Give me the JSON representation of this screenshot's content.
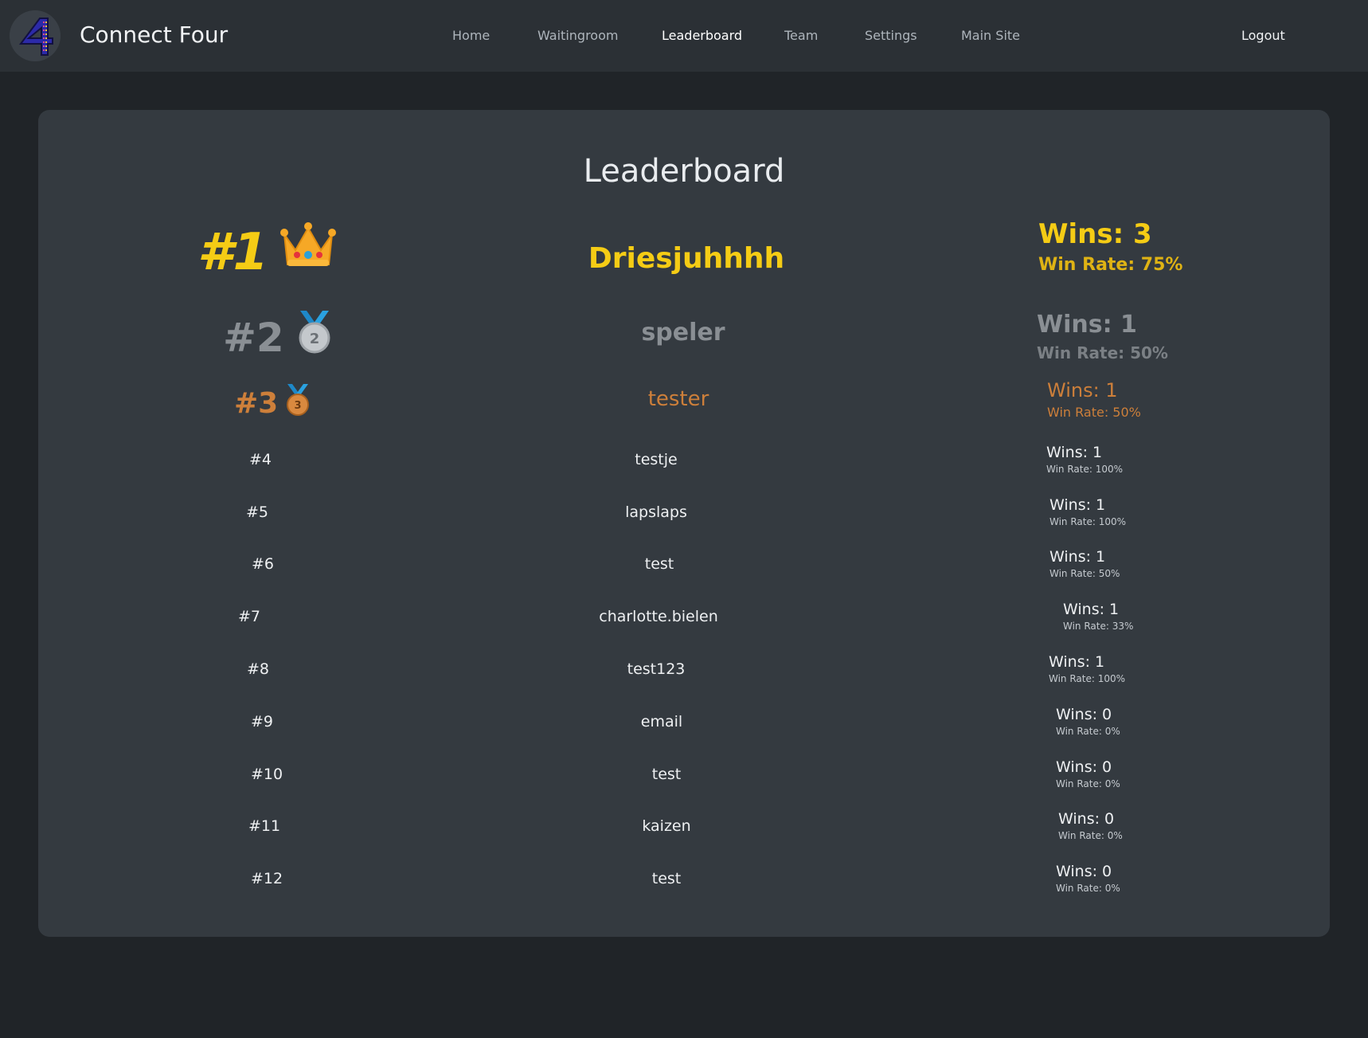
{
  "navbar": {
    "brand": "Connect Four",
    "links": [
      {
        "label": "Home"
      },
      {
        "label": "Waitingroom"
      },
      {
        "label": "Leaderboard"
      },
      {
        "label": "Team"
      },
      {
        "label": "Settings"
      },
      {
        "label": "Main Site"
      }
    ],
    "logout": "Logout",
    "active": "Leaderboard"
  },
  "leaderboard": {
    "title": "Leaderboard",
    "rows": [
      {
        "rank": "#1",
        "name": "Driesjuhhhh",
        "wins": "Wins: 3",
        "rate": "Win Rate: 75%",
        "icon": "crown-icon"
      },
      {
        "rank": "#2",
        "name": "speler",
        "wins": "Wins: 1",
        "rate": "Win Rate: 50%",
        "icon": "silver-medal-icon"
      },
      {
        "rank": "#3",
        "name": "tester",
        "wins": "Wins: 1",
        "rate": "Win Rate: 50%",
        "icon": "bronze-medal-icon"
      },
      {
        "rank": "#4",
        "name": "testje",
        "wins": "Wins: 1",
        "rate": "Win Rate: 100%"
      },
      {
        "rank": "#5",
        "name": "lapslaps",
        "wins": "Wins: 1",
        "rate": "Win Rate: 100%"
      },
      {
        "rank": "#6",
        "name": "test",
        "wins": "Wins: 1",
        "rate": "Win Rate: 50%"
      },
      {
        "rank": "#7",
        "name": "charlotte.bielen",
        "wins": "Wins: 1",
        "rate": "Win Rate: 33%"
      },
      {
        "rank": "#8",
        "name": "test123",
        "wins": "Wins: 1",
        "rate": "Win Rate: 100%"
      },
      {
        "rank": "#9",
        "name": "email",
        "wins": "Wins: 0",
        "rate": "Win Rate: 0%"
      },
      {
        "rank": "#10",
        "name": "test",
        "wins": "Wins: 0",
        "rate": "Win Rate: 0%"
      },
      {
        "rank": "#11",
        "name": "kaizen",
        "wins": "Wins: 0",
        "rate": "Win Rate: 0%"
      },
      {
        "rank": "#12",
        "name": "test",
        "wins": "Wins: 0",
        "rate": "Win Rate: 0%"
      }
    ]
  },
  "colors": {
    "gold": "#f5cc15",
    "silver": "#8a8f94",
    "bronze": "#cd7f3a",
    "background": "#202428",
    "navbar": "#2b3035",
    "card": "#343a40"
  }
}
